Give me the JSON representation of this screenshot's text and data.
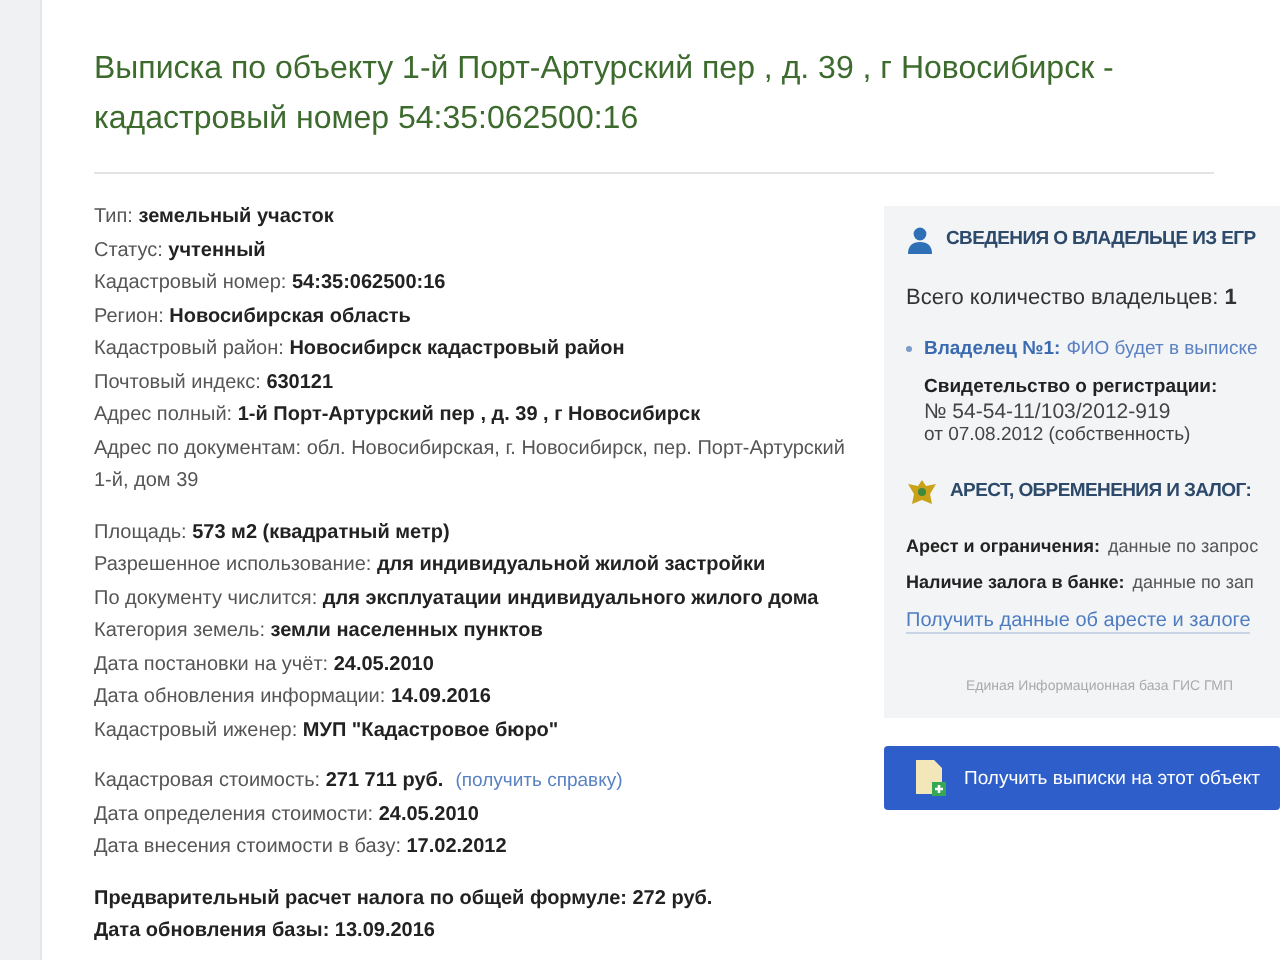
{
  "title": "Выписка по объекту 1-й Порт-Артурский пер , д. 39 , г Новосибирск - кадастровый номер 54:35:062500:16",
  "groups": [
    {
      "lines": [
        {
          "kind": "field",
          "text": "Тип: **земельный участок**"
        },
        {
          "kind": "field",
          "text": "Статус: **учтенный**"
        },
        {
          "kind": "field",
          "text": "Кадастровый номер: **54:35:062500:16**"
        },
        {
          "kind": "field",
          "text": "Регион: **Новосибирская область**"
        },
        {
          "kind": "field",
          "text": "Кадастровый район: **Новосибирск кадастровый район**"
        },
        {
          "kind": "field",
          "text": "Почтовый индекс: **630121**"
        },
        {
          "kind": "field",
          "text": "Адрес полный: **1-й Порт-Артурский пер , д. 39 , г Новосибирск**"
        },
        {
          "kind": "field",
          "text": "Адрес по документам: обл. Новосибирская, г. Новосибирск, пер. Порт-Артурский 1-й, дом 39"
        }
      ]
    },
    {
      "lines": [
        {
          "kind": "field",
          "text": "Площадь: **573 м2 (квадратный метр)**"
        },
        {
          "kind": "field",
          "text": "Разрешенное использование: **для индивидуальной жилой застройки**"
        },
        {
          "kind": "field",
          "text": "По документу числится: **для эксплуатации индивидуального жилого дома**"
        },
        {
          "kind": "field",
          "text": "Категория земель: **земли населенных пунктов**"
        },
        {
          "kind": "field",
          "text": "Дата постановки на учёт: **24.05.2010**"
        },
        {
          "kind": "field",
          "text": "Дата обновления информации: **14.09.2016**"
        },
        {
          "kind": "field",
          "text": "Кадастровый иженер: **МУП \"Кадастровое бюро\"**"
        }
      ]
    },
    {
      "lines": [
        {
          "kind": "field",
          "text": "Кадастровая стоимость: **271 711 руб.**",
          "link": "(получить справку)"
        },
        {
          "kind": "field",
          "text": "Дата определения стоимости: **24.05.2010**"
        },
        {
          "kind": "field",
          "text": "Дата внесения стоимости в базу: **17.02.2012**"
        }
      ]
    },
    {
      "lines": [
        {
          "kind": "summary",
          "text": "Предварительный расчет налога по общей формуле: 272 руб."
        },
        {
          "kind": "summary",
          "text": "Дата обновления базы: 13.09.2016"
        }
      ]
    }
  ],
  "owner_panel": {
    "heading": "СВЕДЕНИЯ О ВЛАДЕЛЬЦЕ ИЗ ЕГР",
    "count": "Всего количество владельцев: **1**",
    "owner_label": "Владелец №1:",
    "owner_link": "ФИО будет в выписке",
    "certificate_title": "Свидетельство о регистрации:",
    "certificate_number": "№ 54-54-11/103/2012-919",
    "certificate_date": "от 07.08.2012 (собственность)"
  },
  "arrest_panel": {
    "heading": "АРЕСТ, ОБРЕМЕНЕНИЯ И ЗАЛОГ:",
    "rows": [
      {
        "label": "Арест и ограничения:",
        "value": "данные по запрос"
      },
      {
        "label": "Наличие залога в банке:",
        "value": "данные по зап"
      }
    ],
    "link": "Получить данные об аресте и залоге",
    "footnote": "Единая Информационная база ГИС ГМП"
  },
  "button": "Получить выписки на этот объект"
}
